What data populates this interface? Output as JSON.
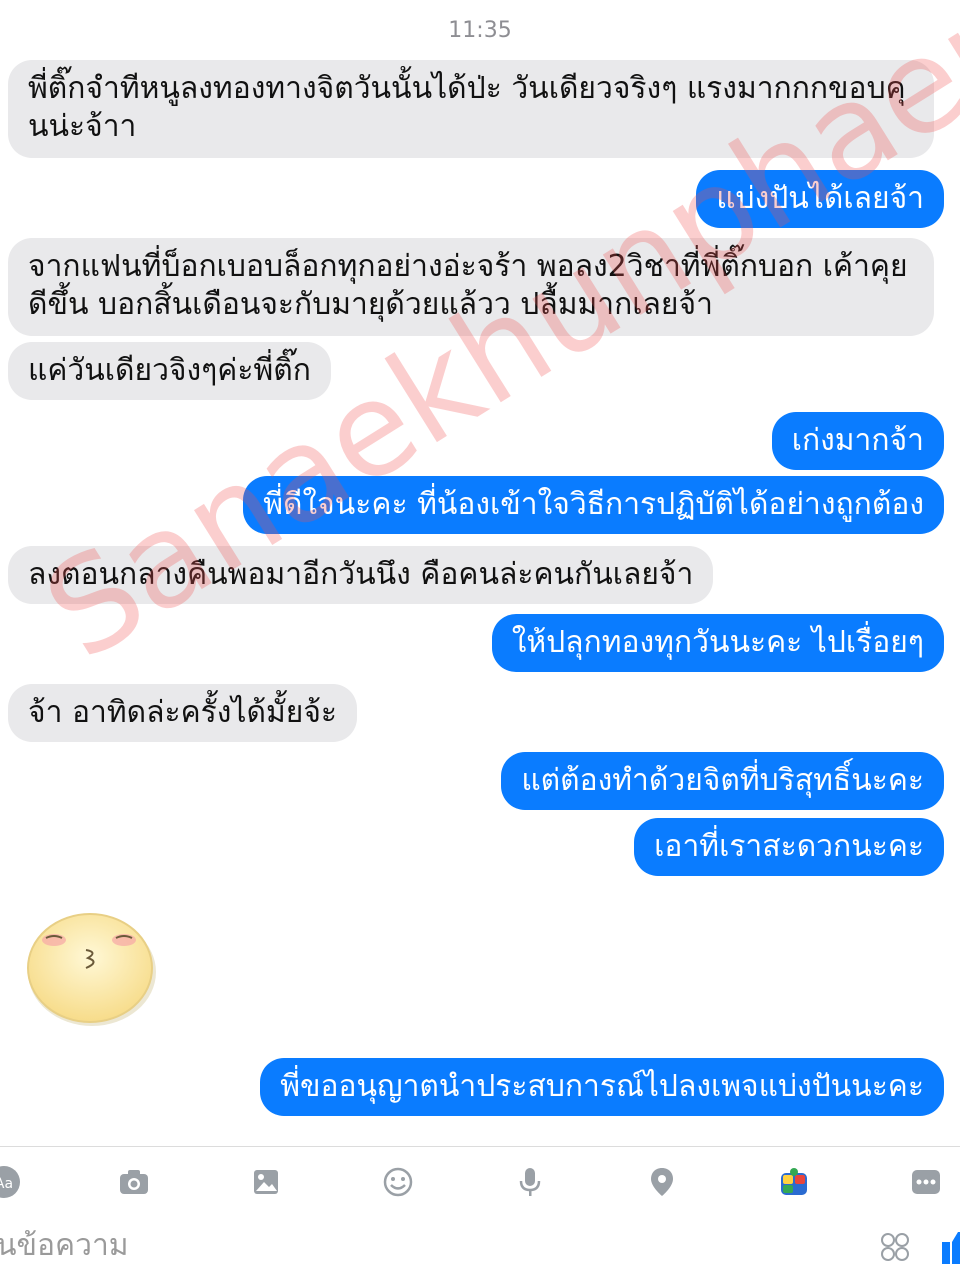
{
  "header": {
    "time": "11:35"
  },
  "messages": [
    {
      "side": "in",
      "text": "พี่ติ๊กจำทีหนูลงทองทางจิตวันนั้นได้ป่ะ วันเดียวจริงๆ แรงมากกกขอบคุนน่ะจ้าา"
    },
    {
      "side": "out",
      "text": "แบ่งปันได้เลยจ้า"
    },
    {
      "side": "in",
      "text": "จากแฟนที่บ็อกเบอบล็อกทุกอย่างอ่ะจร้า พอลง2วิชาที่พี่ติ๊กบอก เค้าคุยดีขึ้น บอกสิ้นเดือนจะกับมายุด้วยแล้วว ปลื้มมากเลยจ้า"
    },
    {
      "side": "in",
      "text": "แค่วันเดียวจิงๆค่ะพี่ติ๊ก"
    },
    {
      "side": "out",
      "text": "เก่งมากจ้า"
    },
    {
      "side": "out",
      "text": "พี่ดีใจนะคะ ที่น้องเข้าใจวิธีการปฏิบัติได้อย่างถูกต้อง"
    },
    {
      "side": "in",
      "text": "ลงตอนกลางคืนพอมาอีกวันนึง คือคนล่ะคนกันเลยจ้า"
    },
    {
      "side": "out",
      "text": "ให้ปลุกทองทุกวันนะคะ ไปเรื่อยๆ"
    },
    {
      "side": "in",
      "text": "จ้า อาทิดล่ะครั้งได้มั้ยจ้ะ"
    },
    {
      "side": "out",
      "text": "แต่ต้องทำด้วยจิตที่บริสุทธิ์นะคะ"
    },
    {
      "side": "out",
      "text": "เอาที่เราสะดวกนะคะ"
    },
    {
      "side": "out",
      "text": "พี่ขออนุญาตนำประสบการณ์ไปลงเพจแบ่งปันนะคะ"
    }
  ],
  "watermark": "Sanaekhunphaen",
  "composer": {
    "placeholder": "นข้อความ"
  },
  "toolbar": {
    "icons": [
      "aa-icon",
      "camera-icon",
      "image-icon",
      "emoji-icon",
      "microphone-icon",
      "location-icon",
      "games-icon",
      "more-icon"
    ],
    "aa_label": "Aa"
  },
  "colors": {
    "outgoing": "#0a7cff",
    "incoming": "#e9e9eb"
  }
}
